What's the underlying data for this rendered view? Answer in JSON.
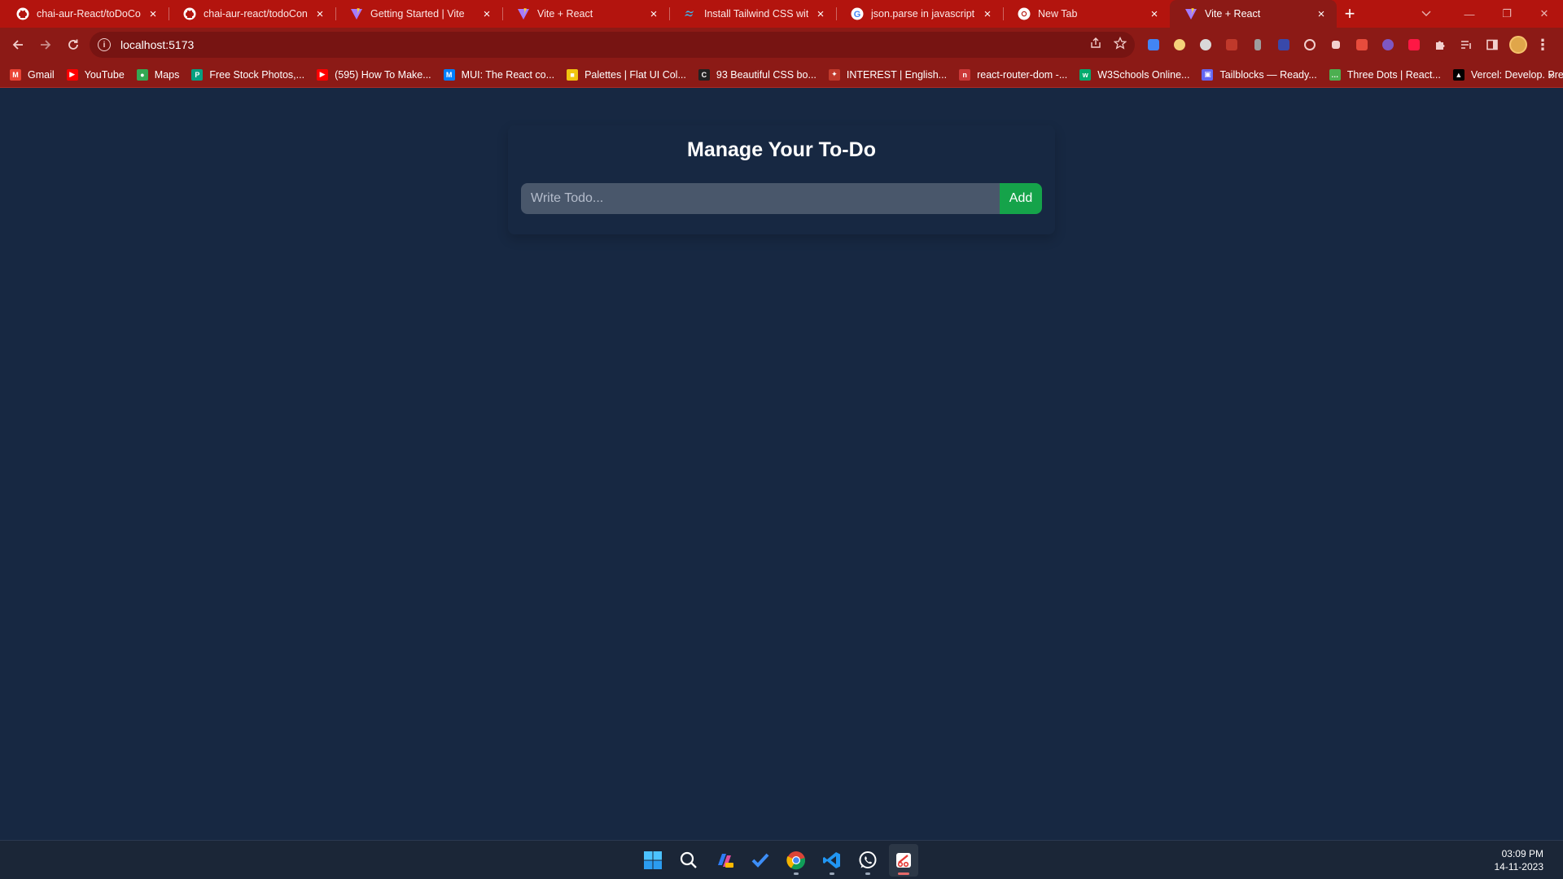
{
  "browser": {
    "tabs": [
      {
        "title": "chai-aur-React/toDoContext",
        "icon": "github-icon",
        "active": false
      },
      {
        "title": "chai-aur-react/todoContext",
        "icon": "github-icon",
        "active": false
      },
      {
        "title": "Getting Started | Vite",
        "icon": "vite-icon",
        "active": false
      },
      {
        "title": "Vite + React",
        "icon": "vite-icon",
        "active": false
      },
      {
        "title": "Install Tailwind CSS with Vite",
        "icon": "tailwind-icon",
        "active": false
      },
      {
        "title": "json.parse in javascript - Google",
        "icon": "google-icon",
        "active": false
      },
      {
        "title": "New Tab",
        "icon": "chrome-icon",
        "active": false
      },
      {
        "title": "Vite + React",
        "icon": "vite-icon",
        "active": true
      }
    ],
    "address": "localhost:5173",
    "bookmarks": [
      {
        "label": "Gmail",
        "color": "#ea4335",
        "glyph": "M"
      },
      {
        "label": "YouTube",
        "color": "#ff0000",
        "glyph": "▶"
      },
      {
        "label": "Maps",
        "color": "#34a853",
        "glyph": "●"
      },
      {
        "label": "Free Stock Photos,...",
        "color": "#05a081",
        "glyph": "P"
      },
      {
        "label": "(595) How To Make...",
        "color": "#ff0000",
        "glyph": "▶"
      },
      {
        "label": "MUI: The React co...",
        "color": "#007fff",
        "glyph": "M"
      },
      {
        "label": "Palettes | Flat UI Col...",
        "color": "#f1c40f",
        "glyph": "■"
      },
      {
        "label": "93 Beautiful CSS bo...",
        "color": "#222222",
        "glyph": "C"
      },
      {
        "label": "INTEREST | English...",
        "color": "#c0392b",
        "glyph": "✦"
      },
      {
        "label": "react-router-dom -...",
        "color": "#cb3837",
        "glyph": "n"
      },
      {
        "label": "W3Schools Online...",
        "color": "#04aa6d",
        "glyph": "w"
      },
      {
        "label": "Tailblocks — Ready...",
        "color": "#6366f1",
        "glyph": "▣"
      },
      {
        "label": "Three Dots | React...",
        "color": "#4caf50",
        "glyph": "…"
      },
      {
        "label": "Vercel: Develop. Pre...",
        "color": "#000000",
        "glyph": "▲"
      }
    ]
  },
  "page": {
    "title": "Manage Your To-Do",
    "input_placeholder": "Write Todo...",
    "input_value": "",
    "add_label": "Add"
  },
  "taskbar": {
    "icons": [
      "windows-start-icon",
      "search-icon",
      "copilot-icon",
      "todo-icon",
      "chrome-icon",
      "vscode-icon",
      "whatsapp-icon",
      "snipping-tool-icon"
    ],
    "time": "03:09 PM",
    "date": "14-11-2023"
  },
  "colors": {
    "page_bg": "#172842",
    "chrome_red": "#b3140e",
    "add_button": "#15a34a"
  }
}
